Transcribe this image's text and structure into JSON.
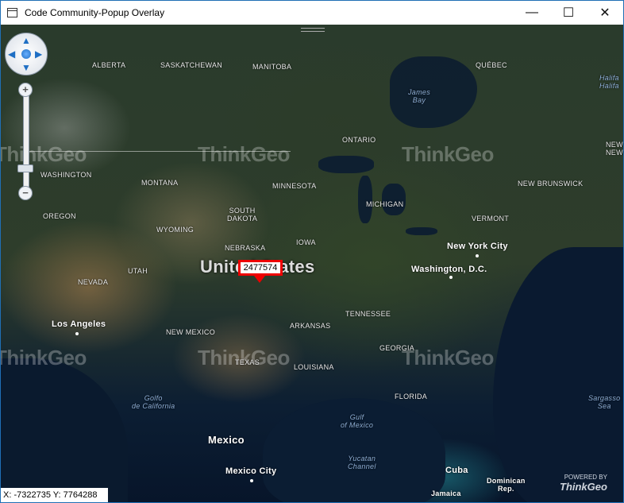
{
  "window": {
    "title": "Code Community-Popup Overlay",
    "minimize_glyph": "—",
    "maximize_glyph": "☐",
    "close_glyph": "✕"
  },
  "map": {
    "watermark": "ThinkGeo",
    "labels": {
      "alberta": "ALBERTA",
      "saskatchewan": "SASKATCHEWAN",
      "manitoba": "MANITOBA",
      "quebec": "QUÉBEC",
      "james_bay": "James\nBay",
      "halifax": "Halifa",
      "halifax2": "Halifa",
      "ontario": "ONTARIO",
      "newfoundland": "NEWF",
      "newfoundland2": "NEWF",
      "washington": "WASHINGTON",
      "montana": "MONTANA",
      "minnesota": "MINNESOTA",
      "new_brunswick": "NEW BRUNSWICK",
      "south_dakota": "SOUTH\nDAKOTA",
      "michigan": "MICHIGAN",
      "vermont": "VERMONT",
      "oregon": "OREGON",
      "wyoming": "WYOMING",
      "nebraska": "NEBRASKA",
      "iowa": "IOWA",
      "new_york": "New York City",
      "washington_dc": "Washington, D.C.",
      "united_states": "United States",
      "nevada": "NEVADA",
      "utah": "UTAH",
      "los_angeles": "Los Angeles",
      "tennessee": "TENNESSEE",
      "new_mexico": "NEW MEXICO",
      "arkansas": "ARKANSAS",
      "georgia": "GEORGIA",
      "texas": "TEXAS",
      "louisiana": "LOUISIANA",
      "florida": "FLORIDA",
      "gulf_california": "Golfo\nde California",
      "gulf_mexico": "Gulf\nof Mexico",
      "sargasso": "Sargasso\nSea",
      "mexico": "Mexico",
      "yucatan": "Yucatan\nChannel",
      "mexico_city": "Mexico City",
      "cuba": "Cuba",
      "dominican": "Dominican\nRep.",
      "jamaica": "Jamaica"
    },
    "popup_text": "2477574",
    "coordinates": "X: -7322735  Y: 7764288",
    "logo_top": "POWERED BY",
    "logo_brand": "ThinkGeo"
  },
  "controls": {
    "pan_up": "▲",
    "pan_down": "▼",
    "pan_left": "◀",
    "pan_right": "▶",
    "zoom_in": "+",
    "zoom_out": "−"
  }
}
